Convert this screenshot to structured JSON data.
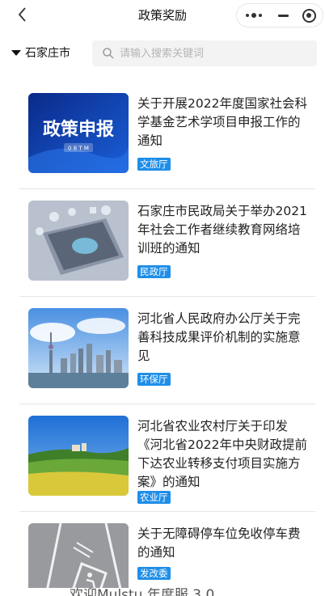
{
  "header": {
    "title": "政策奖励"
  },
  "filter": {
    "city": "石家庄市",
    "search_placeholder": "请输入搜索关键词"
  },
  "thumb_text": {
    "item1_main": "政策申报",
    "item1_sub": "0 8 T M"
  },
  "items": [
    {
      "title": "关于开展2022年度国家社会科学基金艺术学项目申报工作的通知",
      "tag": "文旅厅"
    },
    {
      "title": "石家庄市民政局关于举办2021年社会工作者继续教育网络培训班的通知",
      "tag": "民政厅"
    },
    {
      "title": "河北省人民政府办公厅关于完善科技成果评价机制的实施意见",
      "tag": "环保厅"
    },
    {
      "title": "河北省农业农村厅关于印发《河北省2022年中央财政提前下达农业转移支付项目实施方案》的通知",
      "tag": "农业厅"
    },
    {
      "title": "关于无障碍停车位免收停车费的通知",
      "tag": "发改委"
    }
  ],
  "footer_partial": "欢迎Mulstu 年度服 3.0",
  "colors": {
    "tag_bg": "#1f8ee8",
    "search_bg": "#f3f3f3",
    "divider": "#e6e6e6"
  }
}
